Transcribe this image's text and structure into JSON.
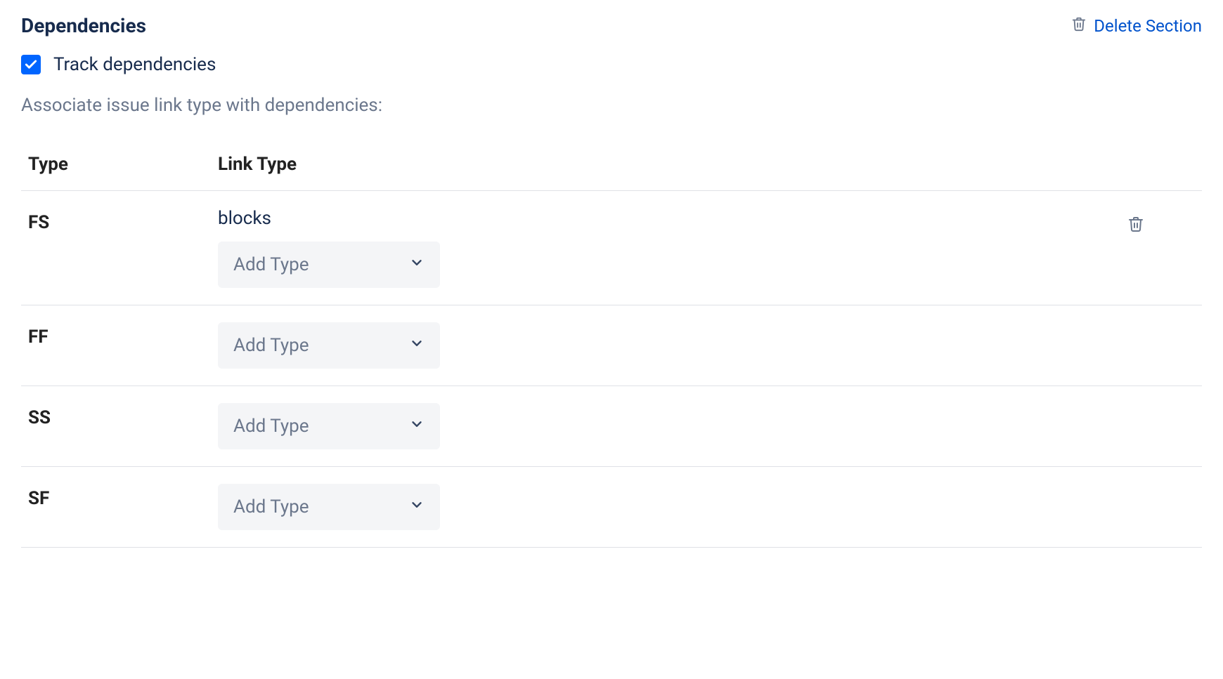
{
  "section": {
    "title": "Dependencies",
    "delete_label": "Delete Section"
  },
  "checkbox": {
    "label": "Track dependencies",
    "checked": true
  },
  "subtext": "Associate issue link type with dependencies:",
  "table": {
    "headers": {
      "type": "Type",
      "link_type": "Link Type"
    },
    "add_type_placeholder": "Add Type",
    "rows": [
      {
        "type": "FS",
        "link": "blocks",
        "has_link": true
      },
      {
        "type": "FF",
        "link": "",
        "has_link": false
      },
      {
        "type": "SS",
        "link": "",
        "has_link": false
      },
      {
        "type": "SF",
        "link": "",
        "has_link": false
      }
    ]
  }
}
